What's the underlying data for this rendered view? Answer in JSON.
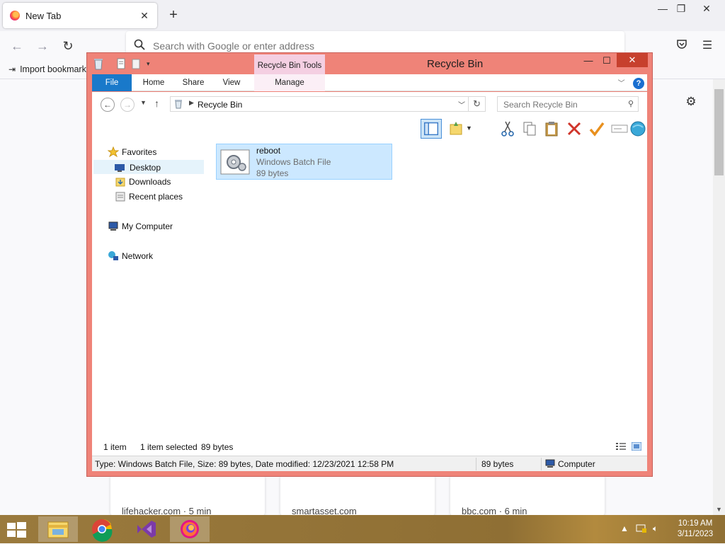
{
  "browser": {
    "tab_title": "New Tab",
    "address_placeholder": "Search with Google or enter address",
    "bookmark_label": "Import bookmarks...",
    "stories": [
      "lifehacker.com · 5 min",
      "smartasset.com",
      "bbc.com · 6 min"
    ]
  },
  "explorer": {
    "title": "Recycle Bin",
    "contextual_tab": "Recycle Bin Tools",
    "ribbon_tabs": [
      "File",
      "Home",
      "Share",
      "View",
      "Manage"
    ],
    "breadcrumb": "Recycle Bin",
    "search_placeholder": "Search Recycle Bin",
    "nav": {
      "favorites": "Favorites",
      "desktop": "Desktop",
      "downloads": "Downloads",
      "recent": "Recent places",
      "computer": "My Computer",
      "network": "Network"
    },
    "file": {
      "name": "reboot",
      "type": "Windows Batch File",
      "size": "89 bytes"
    },
    "status": {
      "count": "1 item",
      "selected": "1 item selected",
      "selected_size": "89 bytes"
    },
    "details": {
      "info": "Type: Windows Batch File, Size: 89 bytes, Date modified: 12/23/2021 12:58 PM",
      "size": "89 bytes",
      "location": "Computer"
    }
  },
  "taskbar": {
    "time": "10:19 AM",
    "date": "3/11/2023"
  },
  "colors": {
    "explorer_frame": "#ef8378",
    "file_tab": "#1979ca",
    "contextual_tab": "#f4cfe2",
    "selection": "#cce8ff"
  }
}
